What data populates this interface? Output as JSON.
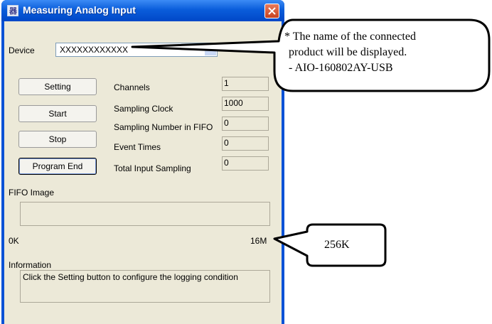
{
  "window": {
    "title": "Measuring Analog Input",
    "app_icon_glyph": "器",
    "close_glyph": "close-icon"
  },
  "device": {
    "label": "Device",
    "value": "XXXXXXXXXXXX"
  },
  "buttons": {
    "setting": "Setting",
    "start": "Start",
    "stop": "Stop",
    "program_end": "Program End"
  },
  "fields": [
    {
      "label": "Channels",
      "value": "1"
    },
    {
      "label": "Sampling Clock",
      "value": "1000"
    },
    {
      "label": "Sampling Number in FIFO",
      "value": "0"
    },
    {
      "label": "Event Times",
      "value": "0"
    },
    {
      "label": "Total Input Sampling",
      "value": "0"
    }
  ],
  "fifo": {
    "label": "FIFO Image",
    "min": "0K",
    "max": "16M",
    "fill": 0
  },
  "information": {
    "label": "Information",
    "text": "Click the Setting button to configure the logging condition"
  },
  "annotations": {
    "device_note_line1": "* The name of the connected",
    "device_note_line2": "product will be displayed.",
    "device_note_line3": "- AIO-160802AY-USB",
    "fifo_note": "256K"
  },
  "colors": {
    "titlebar": "#0a5ddb",
    "client": "#ece9d8",
    "close_button": "#d7552f"
  }
}
